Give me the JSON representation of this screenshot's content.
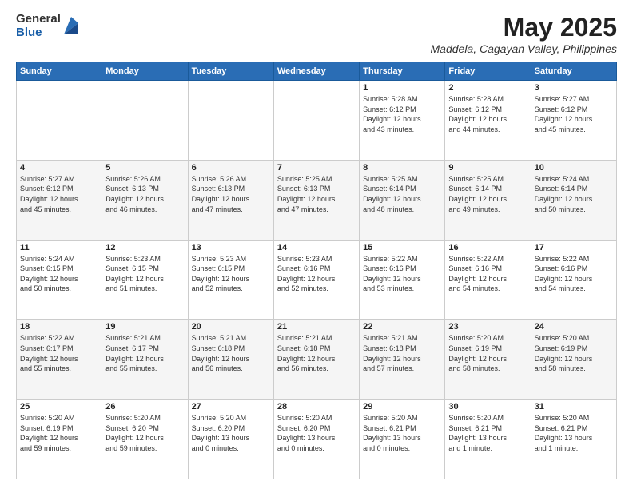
{
  "logo": {
    "general": "General",
    "blue": "Blue"
  },
  "header": {
    "month": "May 2025",
    "location": "Maddela, Cagayan Valley, Philippines"
  },
  "weekdays": [
    "Sunday",
    "Monday",
    "Tuesday",
    "Wednesday",
    "Thursday",
    "Friday",
    "Saturday"
  ],
  "weeks": [
    [
      {
        "day": "",
        "info": ""
      },
      {
        "day": "",
        "info": ""
      },
      {
        "day": "",
        "info": ""
      },
      {
        "day": "",
        "info": ""
      },
      {
        "day": "1",
        "info": "Sunrise: 5:28 AM\nSunset: 6:12 PM\nDaylight: 12 hours\nand 43 minutes."
      },
      {
        "day": "2",
        "info": "Sunrise: 5:28 AM\nSunset: 6:12 PM\nDaylight: 12 hours\nand 44 minutes."
      },
      {
        "day": "3",
        "info": "Sunrise: 5:27 AM\nSunset: 6:12 PM\nDaylight: 12 hours\nand 45 minutes."
      }
    ],
    [
      {
        "day": "4",
        "info": "Sunrise: 5:27 AM\nSunset: 6:12 PM\nDaylight: 12 hours\nand 45 minutes."
      },
      {
        "day": "5",
        "info": "Sunrise: 5:26 AM\nSunset: 6:13 PM\nDaylight: 12 hours\nand 46 minutes."
      },
      {
        "day": "6",
        "info": "Sunrise: 5:26 AM\nSunset: 6:13 PM\nDaylight: 12 hours\nand 47 minutes."
      },
      {
        "day": "7",
        "info": "Sunrise: 5:25 AM\nSunset: 6:13 PM\nDaylight: 12 hours\nand 47 minutes."
      },
      {
        "day": "8",
        "info": "Sunrise: 5:25 AM\nSunset: 6:14 PM\nDaylight: 12 hours\nand 48 minutes."
      },
      {
        "day": "9",
        "info": "Sunrise: 5:25 AM\nSunset: 6:14 PM\nDaylight: 12 hours\nand 49 minutes."
      },
      {
        "day": "10",
        "info": "Sunrise: 5:24 AM\nSunset: 6:14 PM\nDaylight: 12 hours\nand 50 minutes."
      }
    ],
    [
      {
        "day": "11",
        "info": "Sunrise: 5:24 AM\nSunset: 6:15 PM\nDaylight: 12 hours\nand 50 minutes."
      },
      {
        "day": "12",
        "info": "Sunrise: 5:23 AM\nSunset: 6:15 PM\nDaylight: 12 hours\nand 51 minutes."
      },
      {
        "day": "13",
        "info": "Sunrise: 5:23 AM\nSunset: 6:15 PM\nDaylight: 12 hours\nand 52 minutes."
      },
      {
        "day": "14",
        "info": "Sunrise: 5:23 AM\nSunset: 6:16 PM\nDaylight: 12 hours\nand 52 minutes."
      },
      {
        "day": "15",
        "info": "Sunrise: 5:22 AM\nSunset: 6:16 PM\nDaylight: 12 hours\nand 53 minutes."
      },
      {
        "day": "16",
        "info": "Sunrise: 5:22 AM\nSunset: 6:16 PM\nDaylight: 12 hours\nand 54 minutes."
      },
      {
        "day": "17",
        "info": "Sunrise: 5:22 AM\nSunset: 6:16 PM\nDaylight: 12 hours\nand 54 minutes."
      }
    ],
    [
      {
        "day": "18",
        "info": "Sunrise: 5:22 AM\nSunset: 6:17 PM\nDaylight: 12 hours\nand 55 minutes."
      },
      {
        "day": "19",
        "info": "Sunrise: 5:21 AM\nSunset: 6:17 PM\nDaylight: 12 hours\nand 55 minutes."
      },
      {
        "day": "20",
        "info": "Sunrise: 5:21 AM\nSunset: 6:18 PM\nDaylight: 12 hours\nand 56 minutes."
      },
      {
        "day": "21",
        "info": "Sunrise: 5:21 AM\nSunset: 6:18 PM\nDaylight: 12 hours\nand 56 minutes."
      },
      {
        "day": "22",
        "info": "Sunrise: 5:21 AM\nSunset: 6:18 PM\nDaylight: 12 hours\nand 57 minutes."
      },
      {
        "day": "23",
        "info": "Sunrise: 5:20 AM\nSunset: 6:19 PM\nDaylight: 12 hours\nand 58 minutes."
      },
      {
        "day": "24",
        "info": "Sunrise: 5:20 AM\nSunset: 6:19 PM\nDaylight: 12 hours\nand 58 minutes."
      }
    ],
    [
      {
        "day": "25",
        "info": "Sunrise: 5:20 AM\nSunset: 6:19 PM\nDaylight: 12 hours\nand 59 minutes."
      },
      {
        "day": "26",
        "info": "Sunrise: 5:20 AM\nSunset: 6:20 PM\nDaylight: 12 hours\nand 59 minutes."
      },
      {
        "day": "27",
        "info": "Sunrise: 5:20 AM\nSunset: 6:20 PM\nDaylight: 13 hours\nand 0 minutes."
      },
      {
        "day": "28",
        "info": "Sunrise: 5:20 AM\nSunset: 6:20 PM\nDaylight: 13 hours\nand 0 minutes."
      },
      {
        "day": "29",
        "info": "Sunrise: 5:20 AM\nSunset: 6:21 PM\nDaylight: 13 hours\nand 0 minutes."
      },
      {
        "day": "30",
        "info": "Sunrise: 5:20 AM\nSunset: 6:21 PM\nDaylight: 13 hours\nand 1 minute."
      },
      {
        "day": "31",
        "info": "Sunrise: 5:20 AM\nSunset: 6:21 PM\nDaylight: 13 hours\nand 1 minute."
      }
    ]
  ]
}
